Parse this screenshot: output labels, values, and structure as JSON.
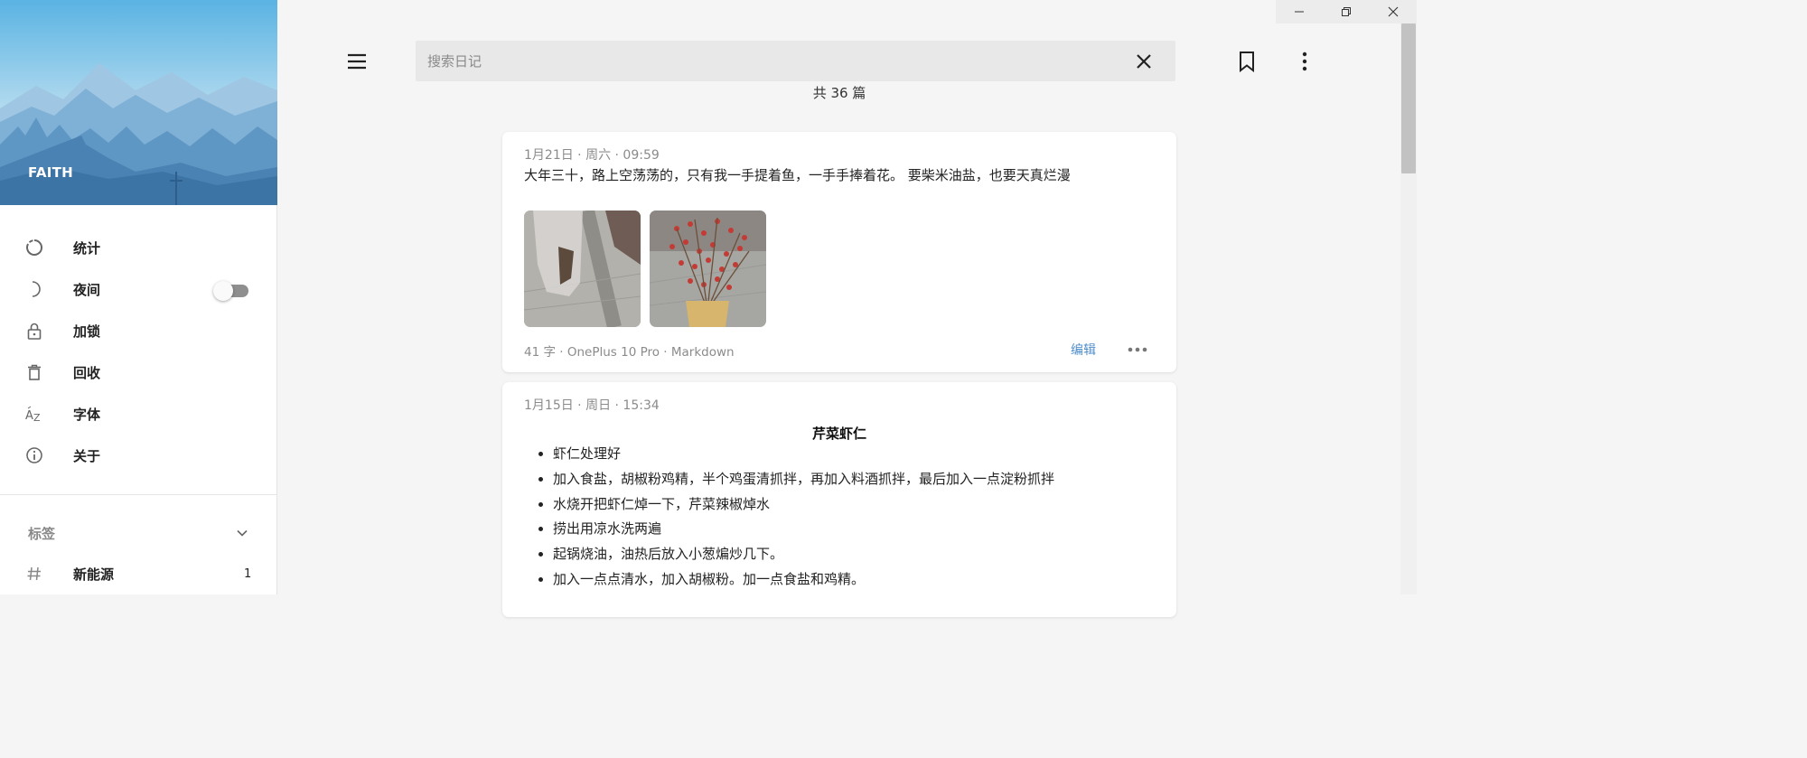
{
  "window": {
    "minimize_icon": "minimize-icon",
    "restore_icon": "restore-icon",
    "close_icon": "close-icon"
  },
  "sidebar": {
    "banner_name": "FAITH",
    "menu": [
      {
        "icon": "stats-ring-icon",
        "label": "统计"
      },
      {
        "icon": "moon-icon",
        "label": "夜间",
        "toggle": false
      },
      {
        "icon": "lock-icon",
        "label": "加锁"
      },
      {
        "icon": "trash-icon",
        "label": "回收"
      },
      {
        "icon": "font-az-icon",
        "label": "字体"
      },
      {
        "icon": "info-icon",
        "label": "关于"
      }
    ],
    "tags": {
      "title": "标签",
      "items": [
        {
          "icon": "hash-icon",
          "label": "新能源",
          "count": "1"
        }
      ]
    }
  },
  "header": {
    "search_placeholder": "搜索日记",
    "search_value": ""
  },
  "summary": "共 36 篇",
  "entries": [
    {
      "meta": "1月21日 · 周六 · 09:59",
      "text": "大年三十，路上空荡荡的，只有我一手提着鱼，一手手捧着花。 要柴米油盐，也要天真烂漫",
      "images": [
        "fish-bag-photo",
        "red-berry-branches-photo"
      ],
      "footer": "41 字 · OnePlus 10 Pro · Markdown",
      "edit_label": "编辑"
    },
    {
      "meta": "1月15日 · 周日 · 15:34",
      "title": "芹菜虾仁",
      "steps": [
        "虾仁处理好",
        "加入食盐，胡椒粉鸡精，半个鸡蛋清抓拌，再加入料酒抓拌，最后加入一点淀粉抓拌",
        "水烧开把虾仁焯一下，芹菜辣椒焯水",
        "捞出用凉水洗两遍",
        "起锅烧油，油热后放入小葱煸炒几下。",
        "加入一点点清水，加入胡椒粉。加一点食盐和鸡精。"
      ]
    }
  ],
  "colors": {
    "accent_link": "#4f8dc9",
    "background": "#f5f5f5",
    "card": "#ffffff"
  }
}
